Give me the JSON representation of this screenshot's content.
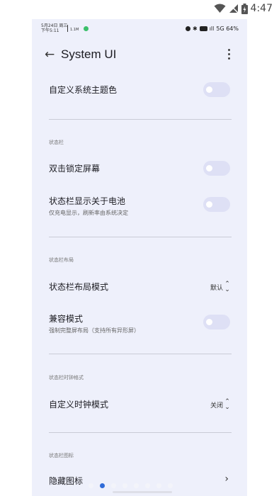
{
  "system_status": {
    "time": "4:47"
  },
  "phone_status": {
    "date_line1": "5月24日 周三",
    "date_line2": "下午5:11",
    "net_speed": "1.1M",
    "right_text": "5G 64%"
  },
  "appbar": {
    "title": "System UI"
  },
  "rows": {
    "custom_theme_color": {
      "label": "自定义系统主题色"
    },
    "double_tap_lock": {
      "label": "双击锁定屏幕"
    },
    "status_bar_battery": {
      "label": "状态栏显示关于电池",
      "sub": "仅充电显示，刷新率由系统决定"
    },
    "status_bar_layout_mode": {
      "label": "状态栏布局模式",
      "value": "默认"
    },
    "compat_mode": {
      "label": "兼容模式",
      "sub": "强制完整屏布局（支持所有异形屏）"
    },
    "custom_clock_mode": {
      "label": "自定义时钟模式",
      "value": "关闭"
    },
    "hide_icons": {
      "label": "隐藏图标"
    }
  },
  "sections": {
    "status_bar": "状态栏",
    "status_bar_layout": "状态栏布局",
    "status_bar_clock_format": "状态栏时钟格式",
    "status_bar_icons": "状态栏图标"
  },
  "toggles": {
    "custom_theme_color": false,
    "double_tap_lock": false,
    "status_bar_battery": false,
    "compat_mode": false
  },
  "pager": {
    "count": 8,
    "active_index": 1
  },
  "colors": {
    "panel_bg": "#eef0fb",
    "switch_off": "#dee0f5",
    "accent": "#2f6bd8"
  }
}
